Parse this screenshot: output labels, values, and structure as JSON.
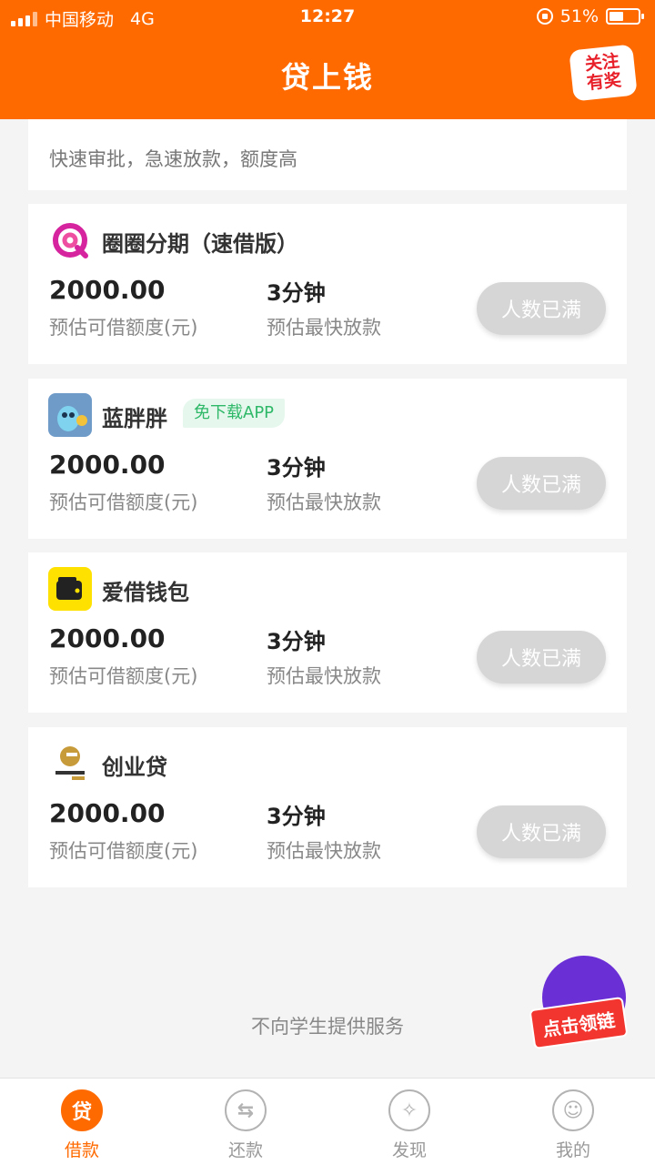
{
  "status_bar": {
    "carrier": "中国移动",
    "network": "4G",
    "time": "12:27",
    "battery": "51%"
  },
  "header": {
    "title": "贷上钱",
    "badge_line1": "关注",
    "badge_line2": "有奖"
  },
  "tagline": "快速审批，急速放款，额度高",
  "loans": [
    {
      "name": "圈圈分期（速借版）",
      "tag": "",
      "amount": "2000.00",
      "amount_label": "预估可借额度(元)",
      "time": "3分钟",
      "time_label": "预估最快放款",
      "button": "人数已满",
      "icon": "ring-logo-icon"
    },
    {
      "name": "蓝胖胖",
      "tag": "免下载APP",
      "amount": "2000.00",
      "amount_label": "预估可借额度(元)",
      "time": "3分钟",
      "time_label": "预估最快放款",
      "button": "人数已满",
      "icon": "mascot-logo-icon"
    },
    {
      "name": "爱借钱包",
      "tag": "",
      "amount": "2000.00",
      "amount_label": "预估可借额度(元)",
      "time": "3分钟",
      "time_label": "预估最快放款",
      "button": "人数已满",
      "icon": "wallet-logo-icon"
    },
    {
      "name": "创业贷",
      "tag": "",
      "amount": "2000.00",
      "amount_label": "预估可借额度(元)",
      "time": "3分钟",
      "time_label": "预估最快放款",
      "button": "人数已满",
      "icon": "chuangyedai-logo-icon"
    }
  ],
  "footer_note": "不向学生提供服务",
  "promo_label": "点击领链",
  "tabs": [
    {
      "label": "借款",
      "glyph": "贷",
      "active": true
    },
    {
      "label": "还款",
      "glyph": "⇆",
      "active": false
    },
    {
      "label": "发现",
      "glyph": "✧",
      "active": false
    },
    {
      "label": "我的",
      "glyph": "☺",
      "active": false
    }
  ],
  "colors": {
    "brand": "#ff6a00",
    "disabled_button": "#d6d6d6",
    "tag_green": "#2fb868"
  }
}
